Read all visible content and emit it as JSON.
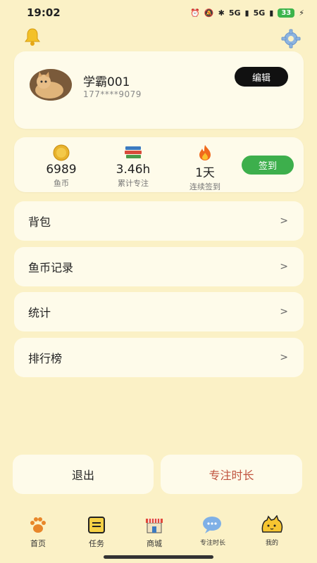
{
  "status": {
    "time": "19:02",
    "signal1": "5G",
    "signal2": "5G",
    "battery": "33"
  },
  "profile": {
    "username": "学霸001",
    "phone": "177****9079",
    "edit_label": "编辑"
  },
  "stats": [
    {
      "value": "6989",
      "label": "鱼币",
      "icon": "coin-icon"
    },
    {
      "value": "3.46h",
      "label": "累计专注",
      "icon": "books-icon"
    },
    {
      "value": "1天",
      "label": "连续签到",
      "icon": "fire-icon"
    }
  ],
  "checkin_label": "签到",
  "menu": [
    {
      "label": "背包",
      "arrow": ">"
    },
    {
      "label": "鱼币记录",
      "arrow": ">"
    },
    {
      "label": "统计",
      "arrow": ">"
    },
    {
      "label": "排行榜",
      "arrow": ">"
    }
  ],
  "actions": {
    "logout": "退出",
    "focus_time": "专注时长"
  },
  "tabs": [
    {
      "label": "首页",
      "icon": "paw-icon"
    },
    {
      "label": "任务",
      "icon": "notebook-icon"
    },
    {
      "label": "商城",
      "icon": "store-icon"
    },
    {
      "label": "专注时长",
      "icon": "chat-bubble-icon"
    },
    {
      "label": "我的",
      "icon": "cat-face-icon"
    }
  ],
  "colors": {
    "background": "#fbf1c6",
    "card": "#fefbea",
    "checkin_green": "#3daf4c",
    "focus_red": "#c0533e"
  }
}
